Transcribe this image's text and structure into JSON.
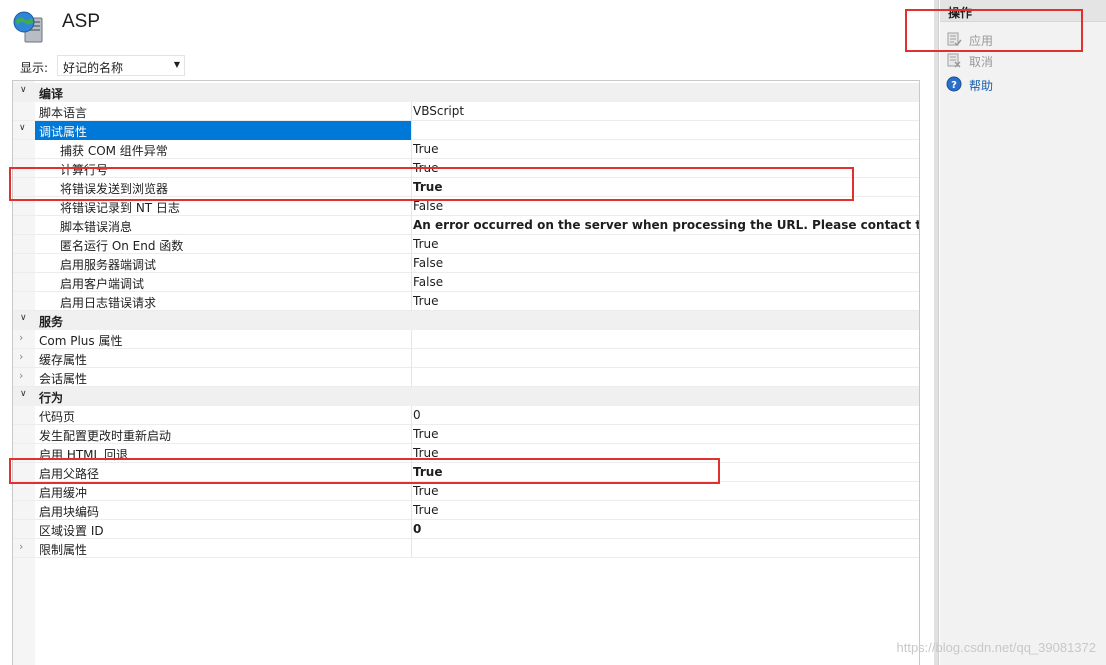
{
  "header": {
    "title": "ASP",
    "icon": "globe-server-icon"
  },
  "toolbar": {
    "display_label": "显示:",
    "display_value": "好记的名称"
  },
  "rows": [
    {
      "kind": "category",
      "expander": "expanded",
      "name": "编译",
      "value": ""
    },
    {
      "kind": "prop",
      "level": 1,
      "name": "脚本语言",
      "value": "VBScript"
    },
    {
      "kind": "prop",
      "level": 1,
      "expander": "expanded",
      "name": "调试属性",
      "value": "",
      "selected": true
    },
    {
      "kind": "prop",
      "level": 2,
      "name": "捕获 COM 组件异常",
      "value": "True"
    },
    {
      "kind": "prop",
      "level": 2,
      "name": "计算行号",
      "value": "True"
    },
    {
      "kind": "prop",
      "level": 2,
      "name": "将错误发送到浏览器",
      "value": "True",
      "bold": true
    },
    {
      "kind": "prop",
      "level": 2,
      "name": "将错误记录到 NT 日志",
      "value": "False"
    },
    {
      "kind": "prop",
      "level": 2,
      "name": "脚本错误消息",
      "value": "An error occurred on the server when processing the URL. Please contact the system administrator.",
      "bold": true
    },
    {
      "kind": "prop",
      "level": 2,
      "name": "匿名运行 On End 函数",
      "value": "True"
    },
    {
      "kind": "prop",
      "level": 2,
      "name": "启用服务器端调试",
      "value": "False"
    },
    {
      "kind": "prop",
      "level": 2,
      "name": "启用客户端调试",
      "value": "False"
    },
    {
      "kind": "prop",
      "level": 2,
      "name": "启用日志错误请求",
      "value": "True"
    },
    {
      "kind": "category",
      "expander": "expanded",
      "name": "服务",
      "value": ""
    },
    {
      "kind": "prop",
      "level": 1,
      "expander": "collapsed",
      "name": "Com Plus 属性",
      "value": ""
    },
    {
      "kind": "prop",
      "level": 1,
      "expander": "collapsed",
      "name": "缓存属性",
      "value": ""
    },
    {
      "kind": "prop",
      "level": 1,
      "expander": "collapsed",
      "name": "会话属性",
      "value": ""
    },
    {
      "kind": "category",
      "expander": "expanded",
      "name": "行为",
      "value": ""
    },
    {
      "kind": "prop",
      "level": 1,
      "name": "代码页",
      "value": "0"
    },
    {
      "kind": "prop",
      "level": 1,
      "name": "发生配置更改时重新启动",
      "value": "True"
    },
    {
      "kind": "prop",
      "level": 1,
      "name": "启用 HTML 回退",
      "value": "True"
    },
    {
      "kind": "prop",
      "level": 1,
      "name": "启用父路径",
      "value": "True",
      "bold": true
    },
    {
      "kind": "prop",
      "level": 1,
      "name": "启用缓冲",
      "value": "True"
    },
    {
      "kind": "prop",
      "level": 1,
      "name": "启用块编码",
      "value": "True"
    },
    {
      "kind": "prop",
      "level": 1,
      "name": "区域设置 ID",
      "value": "0",
      "bold": true
    },
    {
      "kind": "prop",
      "level": 1,
      "expander": "collapsed",
      "name": "限制属性",
      "value": ""
    }
  ],
  "actions": {
    "title": "操作",
    "items": [
      {
        "label": "应用",
        "icon": "apply-icon",
        "state": "disabled"
      },
      {
        "label": "取消",
        "icon": "cancel-icon",
        "state": "disabled"
      },
      {
        "label": "帮助",
        "icon": "help-icon",
        "state": "link"
      }
    ]
  },
  "watermark": "https://blog.csdn.net/qq_39081372",
  "colors": {
    "selection": "#0078d7",
    "annotation": "#e0312f",
    "link": "#1a5ea8"
  }
}
